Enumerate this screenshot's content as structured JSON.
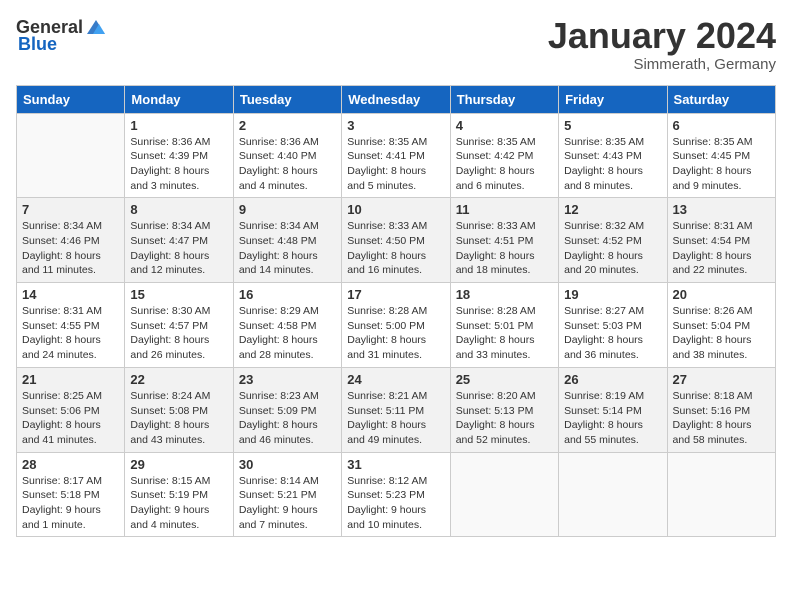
{
  "header": {
    "logo_general": "General",
    "logo_blue": "Blue",
    "month": "January 2024",
    "location": "Simmerath, Germany"
  },
  "weekdays": [
    "Sunday",
    "Monday",
    "Tuesday",
    "Wednesday",
    "Thursday",
    "Friday",
    "Saturday"
  ],
  "weeks": [
    [
      {
        "day": "",
        "info": ""
      },
      {
        "day": "1",
        "info": "Sunrise: 8:36 AM\nSunset: 4:39 PM\nDaylight: 8 hours\nand 3 minutes."
      },
      {
        "day": "2",
        "info": "Sunrise: 8:36 AM\nSunset: 4:40 PM\nDaylight: 8 hours\nand 4 minutes."
      },
      {
        "day": "3",
        "info": "Sunrise: 8:35 AM\nSunset: 4:41 PM\nDaylight: 8 hours\nand 5 minutes."
      },
      {
        "day": "4",
        "info": "Sunrise: 8:35 AM\nSunset: 4:42 PM\nDaylight: 8 hours\nand 6 minutes."
      },
      {
        "day": "5",
        "info": "Sunrise: 8:35 AM\nSunset: 4:43 PM\nDaylight: 8 hours\nand 8 minutes."
      },
      {
        "day": "6",
        "info": "Sunrise: 8:35 AM\nSunset: 4:45 PM\nDaylight: 8 hours\nand 9 minutes."
      }
    ],
    [
      {
        "day": "7",
        "info": "Sunrise: 8:34 AM\nSunset: 4:46 PM\nDaylight: 8 hours\nand 11 minutes."
      },
      {
        "day": "8",
        "info": "Sunrise: 8:34 AM\nSunset: 4:47 PM\nDaylight: 8 hours\nand 12 minutes."
      },
      {
        "day": "9",
        "info": "Sunrise: 8:34 AM\nSunset: 4:48 PM\nDaylight: 8 hours\nand 14 minutes."
      },
      {
        "day": "10",
        "info": "Sunrise: 8:33 AM\nSunset: 4:50 PM\nDaylight: 8 hours\nand 16 minutes."
      },
      {
        "day": "11",
        "info": "Sunrise: 8:33 AM\nSunset: 4:51 PM\nDaylight: 8 hours\nand 18 minutes."
      },
      {
        "day": "12",
        "info": "Sunrise: 8:32 AM\nSunset: 4:52 PM\nDaylight: 8 hours\nand 20 minutes."
      },
      {
        "day": "13",
        "info": "Sunrise: 8:31 AM\nSunset: 4:54 PM\nDaylight: 8 hours\nand 22 minutes."
      }
    ],
    [
      {
        "day": "14",
        "info": "Sunrise: 8:31 AM\nSunset: 4:55 PM\nDaylight: 8 hours\nand 24 minutes."
      },
      {
        "day": "15",
        "info": "Sunrise: 8:30 AM\nSunset: 4:57 PM\nDaylight: 8 hours\nand 26 minutes."
      },
      {
        "day": "16",
        "info": "Sunrise: 8:29 AM\nSunset: 4:58 PM\nDaylight: 8 hours\nand 28 minutes."
      },
      {
        "day": "17",
        "info": "Sunrise: 8:28 AM\nSunset: 5:00 PM\nDaylight: 8 hours\nand 31 minutes."
      },
      {
        "day": "18",
        "info": "Sunrise: 8:28 AM\nSunset: 5:01 PM\nDaylight: 8 hours\nand 33 minutes."
      },
      {
        "day": "19",
        "info": "Sunrise: 8:27 AM\nSunset: 5:03 PM\nDaylight: 8 hours\nand 36 minutes."
      },
      {
        "day": "20",
        "info": "Sunrise: 8:26 AM\nSunset: 5:04 PM\nDaylight: 8 hours\nand 38 minutes."
      }
    ],
    [
      {
        "day": "21",
        "info": "Sunrise: 8:25 AM\nSunset: 5:06 PM\nDaylight: 8 hours\nand 41 minutes."
      },
      {
        "day": "22",
        "info": "Sunrise: 8:24 AM\nSunset: 5:08 PM\nDaylight: 8 hours\nand 43 minutes."
      },
      {
        "day": "23",
        "info": "Sunrise: 8:23 AM\nSunset: 5:09 PM\nDaylight: 8 hours\nand 46 minutes."
      },
      {
        "day": "24",
        "info": "Sunrise: 8:21 AM\nSunset: 5:11 PM\nDaylight: 8 hours\nand 49 minutes."
      },
      {
        "day": "25",
        "info": "Sunrise: 8:20 AM\nSunset: 5:13 PM\nDaylight: 8 hours\nand 52 minutes."
      },
      {
        "day": "26",
        "info": "Sunrise: 8:19 AM\nSunset: 5:14 PM\nDaylight: 8 hours\nand 55 minutes."
      },
      {
        "day": "27",
        "info": "Sunrise: 8:18 AM\nSunset: 5:16 PM\nDaylight: 8 hours\nand 58 minutes."
      }
    ],
    [
      {
        "day": "28",
        "info": "Sunrise: 8:17 AM\nSunset: 5:18 PM\nDaylight: 9 hours\nand 1 minute."
      },
      {
        "day": "29",
        "info": "Sunrise: 8:15 AM\nSunset: 5:19 PM\nDaylight: 9 hours\nand 4 minutes."
      },
      {
        "day": "30",
        "info": "Sunrise: 8:14 AM\nSunset: 5:21 PM\nDaylight: 9 hours\nand 7 minutes."
      },
      {
        "day": "31",
        "info": "Sunrise: 8:12 AM\nSunset: 5:23 PM\nDaylight: 9 hours\nand 10 minutes."
      },
      {
        "day": "",
        "info": ""
      },
      {
        "day": "",
        "info": ""
      },
      {
        "day": "",
        "info": ""
      }
    ]
  ]
}
